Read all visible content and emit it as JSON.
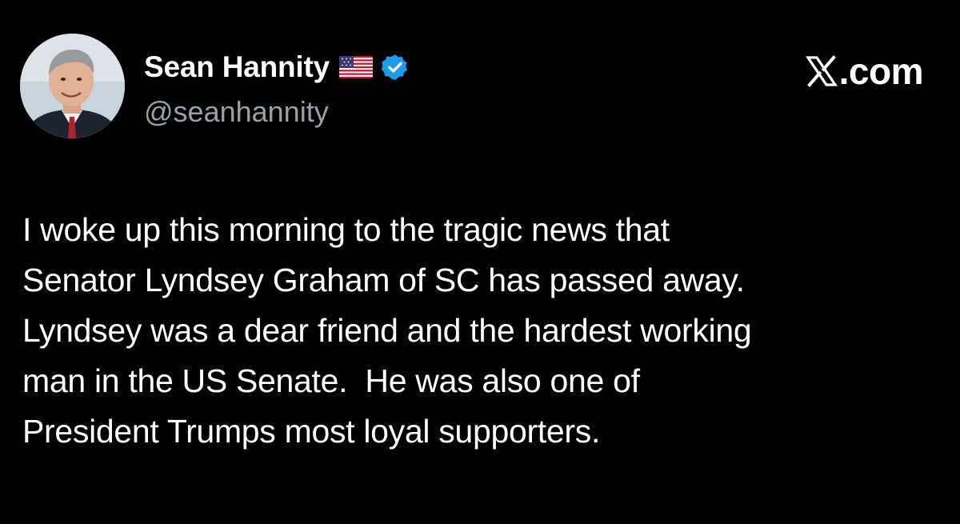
{
  "tweet": {
    "author": {
      "display_name": "Sean Hannity",
      "handle": "@seanhannity",
      "avatar": "avatar",
      "flag_icon": "us-flag-icon",
      "verified_icon": "verified-badge-icon",
      "verified_color": "#1d9bf0"
    },
    "brand": {
      "logo_icon": "x-logo-icon",
      "suffix": ".com"
    },
    "body_lines": [
      "I woke up this morning to the tragic news that",
      "Senator Lyndsey Graham of SC has passed away.",
      "Lyndsey was a dear friend and the hardest working",
      "man in the US Senate.  He was also one of",
      "President Trumps most loyal supporters."
    ]
  },
  "colors": {
    "background": "#000000",
    "text_primary": "#ffffff",
    "text_secondary": "#9aa1a8"
  }
}
